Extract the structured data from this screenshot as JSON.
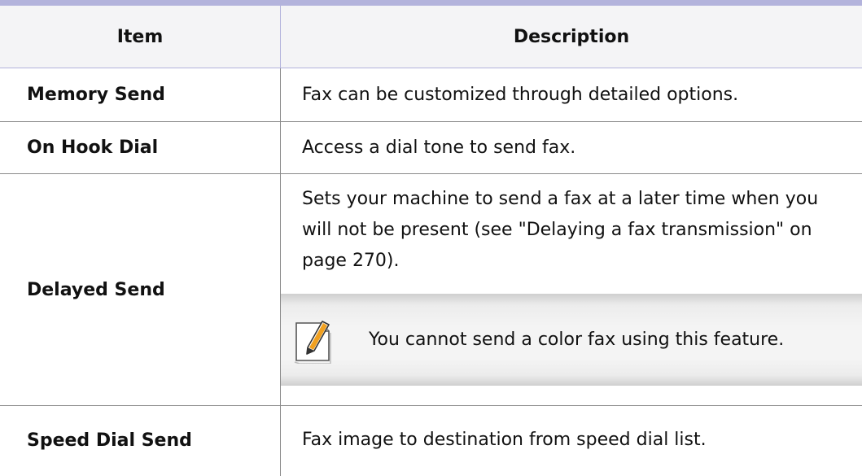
{
  "table": {
    "headers": {
      "item": "Item",
      "description": "Description"
    },
    "rows": [
      {
        "item": "Memory Send",
        "description": "Fax can be customized through detailed options."
      },
      {
        "item": "On Hook Dial",
        "description": "Access a dial tone to send fax."
      },
      {
        "item": "Delayed Send",
        "description_lines": [
          "Sets your machine to send a fax at a later time when you",
          "will not be present (see \"Delaying a fax transmission\" on",
          "page 270)."
        ],
        "note": "You cannot send a color fax using this feature."
      },
      {
        "item": "Speed Dial Send",
        "description": "Fax image to destination from speed dial list."
      }
    ]
  },
  "colors": {
    "header_rule": "#b3b3dc",
    "header_background": "#f4f4f6",
    "note_background": "#f4f4f4",
    "note_icon_accent": "#f0a020"
  },
  "icons": {
    "note": "note-pencil-icon"
  }
}
